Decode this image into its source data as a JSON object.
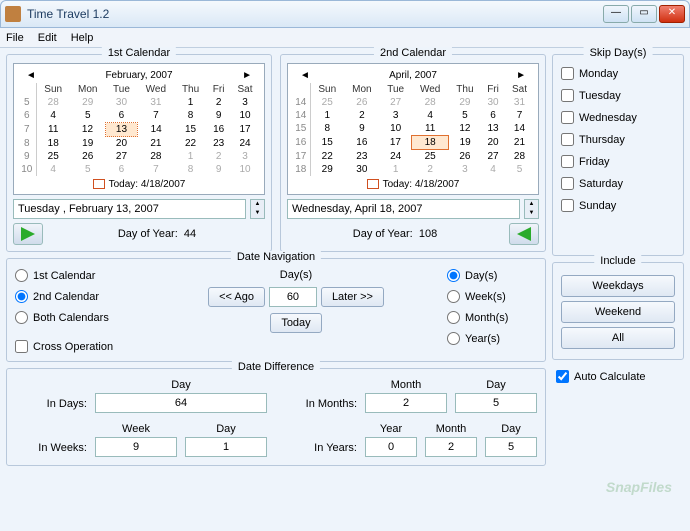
{
  "window": {
    "title": "Time Travel 1.2"
  },
  "menu": {
    "file": "File",
    "edit": "Edit",
    "help": "Help"
  },
  "cal1": {
    "header": "1st Calendar",
    "month": "February, 2007",
    "today": "Today: 4/18/2007",
    "date": "Tuesday , February 13, 2007",
    "doy_label": "Day of Year:",
    "doy": "44",
    "weeks": [
      "5",
      "6",
      "7",
      "8",
      "9",
      "10"
    ],
    "days": [
      "Sun",
      "Mon",
      "Tue",
      "Wed",
      "Thu",
      "Fri",
      "Sat"
    ],
    "grid": [
      [
        "28",
        "29",
        "30",
        "31",
        "1",
        "2",
        "3"
      ],
      [
        "4",
        "5",
        "6",
        "7",
        "8",
        "9",
        "10"
      ],
      [
        "11",
        "12",
        "13",
        "14",
        "15",
        "16",
        "17"
      ],
      [
        "18",
        "19",
        "20",
        "21",
        "22",
        "23",
        "24"
      ],
      [
        "25",
        "26",
        "27",
        "28",
        "1",
        "2",
        "3"
      ],
      [
        "4",
        "5",
        "6",
        "7",
        "8",
        "9",
        "10"
      ]
    ],
    "gray_rows": {
      "0": [
        0,
        1,
        2,
        3
      ],
      "4": [
        4,
        5,
        6
      ],
      "5": [
        0,
        1,
        2,
        3,
        4,
        5,
        6
      ]
    },
    "sel": [
      2,
      2
    ]
  },
  "cal2": {
    "header": "2nd Calendar",
    "month": "April, 2007",
    "today": "Today: 4/18/2007",
    "date": "Wednesday, April 18, 2007",
    "doy_label": "Day of Year:",
    "doy": "108",
    "weeks": [
      "14",
      "14",
      "15",
      "16",
      "17",
      "18"
    ],
    "days": [
      "Sun",
      "Mon",
      "Tue",
      "Wed",
      "Thu",
      "Fri",
      "Sat"
    ],
    "grid": [
      [
        "25",
        "26",
        "27",
        "28",
        "29",
        "30",
        "31"
      ],
      [
        "1",
        "2",
        "3",
        "4",
        "5",
        "6",
        "7"
      ],
      [
        "8",
        "9",
        "10",
        "11",
        "12",
        "13",
        "14"
      ],
      [
        "15",
        "16",
        "17",
        "18",
        "19",
        "20",
        "21"
      ],
      [
        "22",
        "23",
        "24",
        "25",
        "26",
        "27",
        "28"
      ],
      [
        "29",
        "30",
        "1",
        "2",
        "3",
        "4",
        "5"
      ]
    ],
    "gray_rows": {
      "0": [
        0,
        1,
        2,
        3,
        4,
        5,
        6
      ],
      "5": [
        2,
        3,
        4,
        5,
        6
      ]
    },
    "sel": [
      3,
      3
    ]
  },
  "skip": {
    "title": "Skip Day(s)",
    "days": [
      "Monday",
      "Tuesday",
      "Wednesday",
      "Thursday",
      "Friday",
      "Saturday",
      "Sunday"
    ]
  },
  "nav": {
    "title": "Date Navigation",
    "r1": "1st Calendar",
    "r2": "2nd Calendar",
    "r3": "Both Calendars",
    "cross": "Cross Operation",
    "days_hdr": "Day(s)",
    "ago": "<< Ago",
    "later": "Later >>",
    "today_btn": "Today",
    "value": "60",
    "u1": "Day(s)",
    "u2": "Week(s)",
    "u3": "Month(s)",
    "u4": "Year(s)"
  },
  "include": {
    "title": "Include",
    "wd": "Weekdays",
    "we": "Weekend",
    "all": "All",
    "auto": "Auto Calculate"
  },
  "diff": {
    "title": "Date Difference",
    "in_days": "In Days:",
    "in_weeks": "In Weeks:",
    "in_months": "In Months:",
    "in_years": "In Years:",
    "h_day": "Day",
    "h_week": "Week",
    "h_month": "Month",
    "h_year": "Year",
    "days_val": "64",
    "weeks_w": "9",
    "weeks_d": "1",
    "months_m": "2",
    "months_d": "5",
    "years_y": "0",
    "years_m": "2",
    "years_d": "5"
  },
  "watermark": "SnapFiles"
}
